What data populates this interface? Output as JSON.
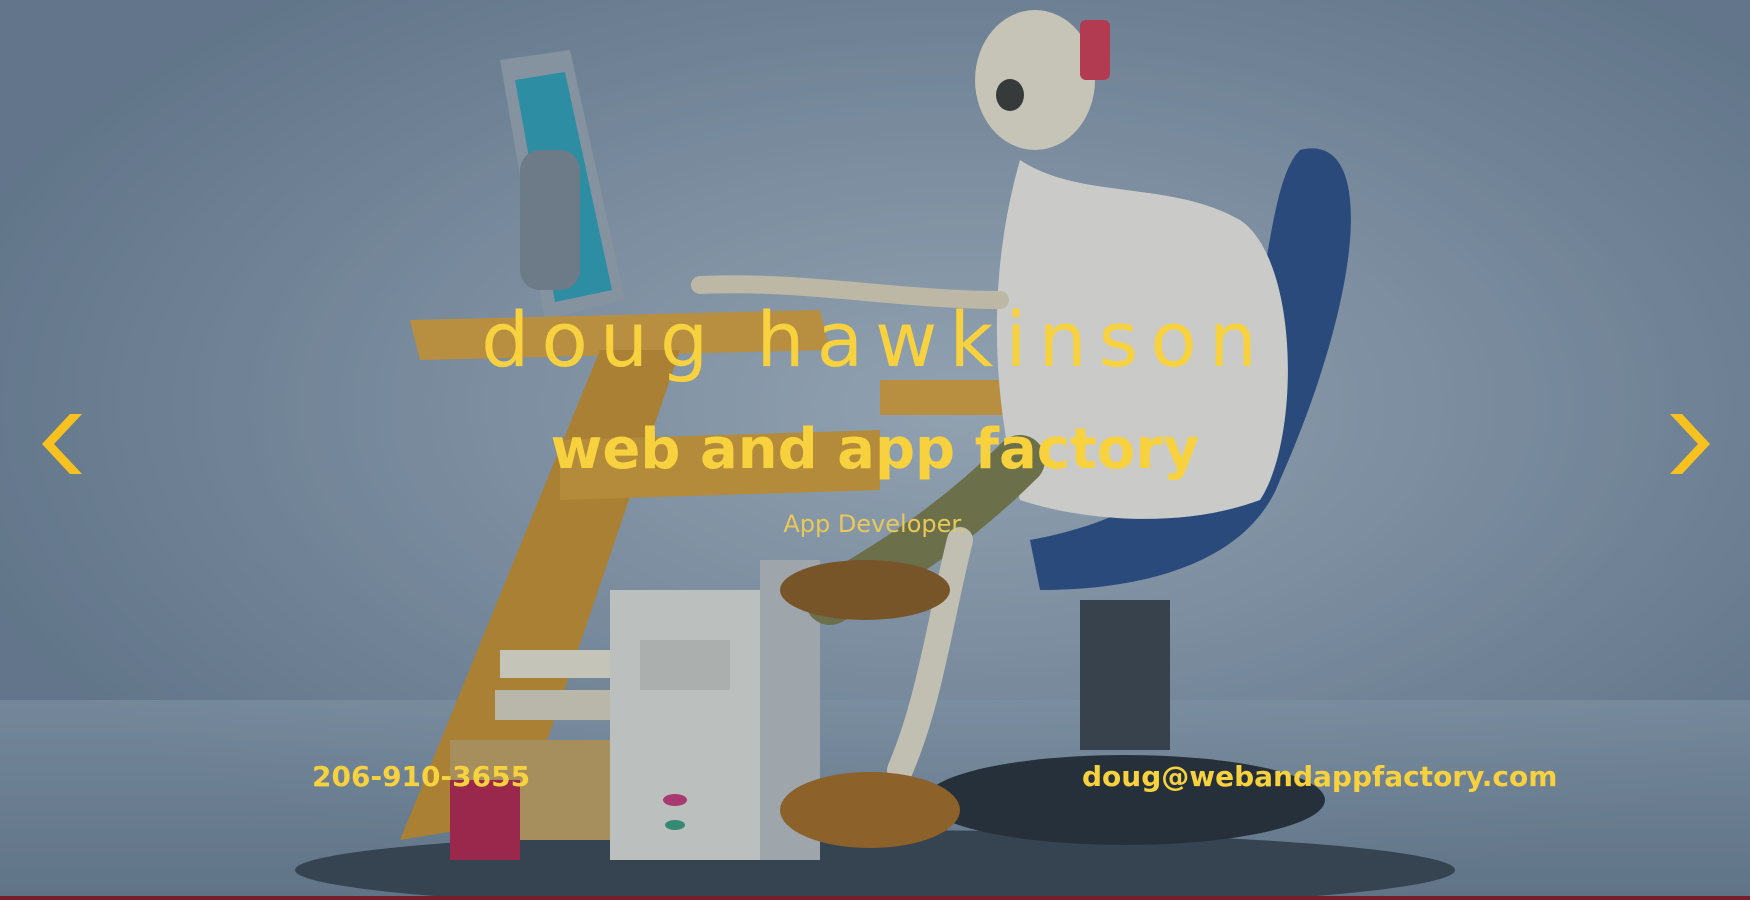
{
  "hero": {
    "name": "doug hawkinson",
    "company": "web and app factory",
    "role": "App Developer."
  },
  "carousel": {
    "prev_icon": "chevron-left-icon",
    "next_icon": "chevron-right-icon"
  },
  "contact": {
    "phone": "206-910-3655",
    "email": "doug@webandappfactory.com"
  },
  "colors": {
    "accent": "#f7d23e",
    "background": "#8a9db0",
    "bottom_bar": "#7a1d2a"
  }
}
